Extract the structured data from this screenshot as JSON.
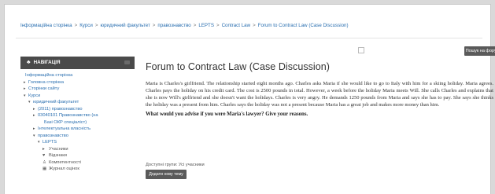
{
  "breadcrumb": [
    "Інформаційна сторінка",
    "Курси",
    "юридичний факультет",
    "правознавство",
    "LEPTS",
    "Contract Law",
    "Forum to Contract Law (Case Discussion)"
  ],
  "breadcrumb_separator": ">",
  "search": {
    "button_label": "Пошук на форумах"
  },
  "nav": {
    "header": "НАВІГАЦІЯ",
    "items": [
      {
        "label": "Інформаційна сторінка",
        "arrow": ""
      },
      {
        "label": "Головна сторінка",
        "arrow": "▸"
      },
      {
        "label": "Сторінки сайту",
        "arrow": "▸"
      },
      {
        "label": "Курси",
        "arrow": "▾"
      },
      {
        "label": "юридичний факультет",
        "arrow": "▾"
      },
      {
        "label": "(2011) правознавство",
        "arrow": "▸"
      },
      {
        "label": "03040101 Правознавство (на",
        "arrow": "▸"
      },
      {
        "label": "Базі ОКР спеціаліст)",
        "arrow": ""
      },
      {
        "label": "Інтелектуальна власність",
        "arrow": "▸"
      },
      {
        "label": "правознавство",
        "arrow": "▾"
      },
      {
        "label": "LEPTS",
        "arrow": "▾"
      },
      {
        "label": "Учасники",
        "icon": "▸"
      },
      {
        "label": "Відзнаки",
        "icon": "♥"
      },
      {
        "label": "Компетентності",
        "icon": "♙"
      },
      {
        "label": "Журнал оцінок",
        "icon": "▦"
      }
    ]
  },
  "main": {
    "title": "Forum to Contract Law (Case Discussion)",
    "description": "Maria is Charles's girlfriend. The relationship started eight months ago. Charles asks Maria if she would like to go to Italy with him for a skiing holiday. Maria agrees. Charles pays the holiday on his credit card. The cost is 2500 pounds in total. However, a week before the holiday Maria meets Will. She calls Charles and explains that she is now Will's girlfriend and she doesn't want the holidays. Charles is very angry. He demands 1250 pounds from Maria and says she has to pay. She says she thinks the holiday was a present from him. Charles says the holiday was not a present because Maria has a great job and makes more money than him.",
    "question": "What would you advise if you were Maria's lawyer? Give your reasons.",
    "groups_label": "Доступні групи: Усі учасники",
    "add_topic_label": "Додати нову тему"
  },
  "colors": {
    "link": "#2a6fb0",
    "button_bg": "#5a5a5a",
    "nav_header_bg": "#4a4a4a"
  }
}
